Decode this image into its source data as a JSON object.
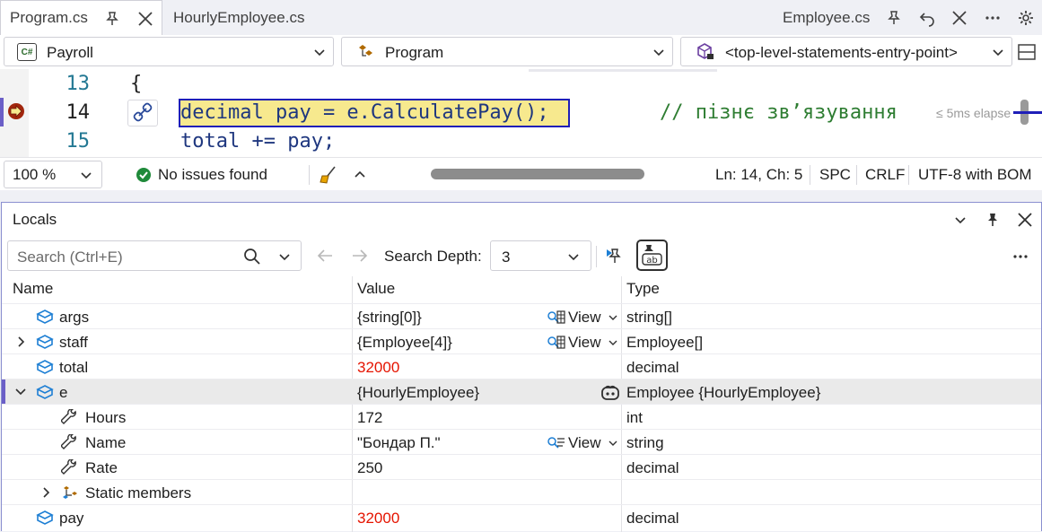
{
  "tabs": {
    "active": "Program.cs",
    "second": "HourlyEmployee.cs",
    "right": "Employee.cs"
  },
  "navbar": {
    "project": "Payroll",
    "project_badge": "C#",
    "type": "Program",
    "member": "<top-level-statements-entry-point>"
  },
  "editor": {
    "line13": "13",
    "line14": "14",
    "line15": "15",
    "code13": "{",
    "code14": "decimal pay = e.CalculatePay();",
    "comment14": "// пізнє зв’язування",
    "code15": "total += pay;",
    "elapsed": "≤ 5ms elapse"
  },
  "status": {
    "zoom": "100 %",
    "issues": "No issues found",
    "position": "Ln: 14, Ch: 5",
    "indent": "SPC",
    "line_ending": "CRLF",
    "encoding": "UTF-8 with BOM"
  },
  "locals": {
    "title": "Locals",
    "search_placeholder": "Search (Ctrl+E)",
    "depth_label": "Search Depth:",
    "depth_value": "3",
    "columns": {
      "name": "Name",
      "value": "Value",
      "type": "Type"
    },
    "view_label": "View",
    "rows": [
      {
        "name": "args",
        "value": "{string[0]}",
        "type": "string[]"
      },
      {
        "name": "staff",
        "value": "{Employee[4]}",
        "type": "Employee[]"
      },
      {
        "name": "total",
        "value": "32000",
        "type": "decimal"
      },
      {
        "name": "e",
        "value": "{HourlyEmployee}",
        "type": "Employee {HourlyEmployee}"
      },
      {
        "name": "Hours",
        "value": "172",
        "type": "int"
      },
      {
        "name": "Name",
        "value": "\"Бондар П.\"",
        "type": "string"
      },
      {
        "name": "Rate",
        "value": "250",
        "type": "decimal"
      },
      {
        "name": "Static members",
        "value": "",
        "type": ""
      },
      {
        "name": "pay",
        "value": "32000",
        "type": "decimal"
      }
    ]
  },
  "colors": {
    "accent": "#6b5fc7",
    "changed_value": "#e51400",
    "highlight": "#f7e98e",
    "comment": "#2e7d32",
    "line_number": "#237893"
  }
}
